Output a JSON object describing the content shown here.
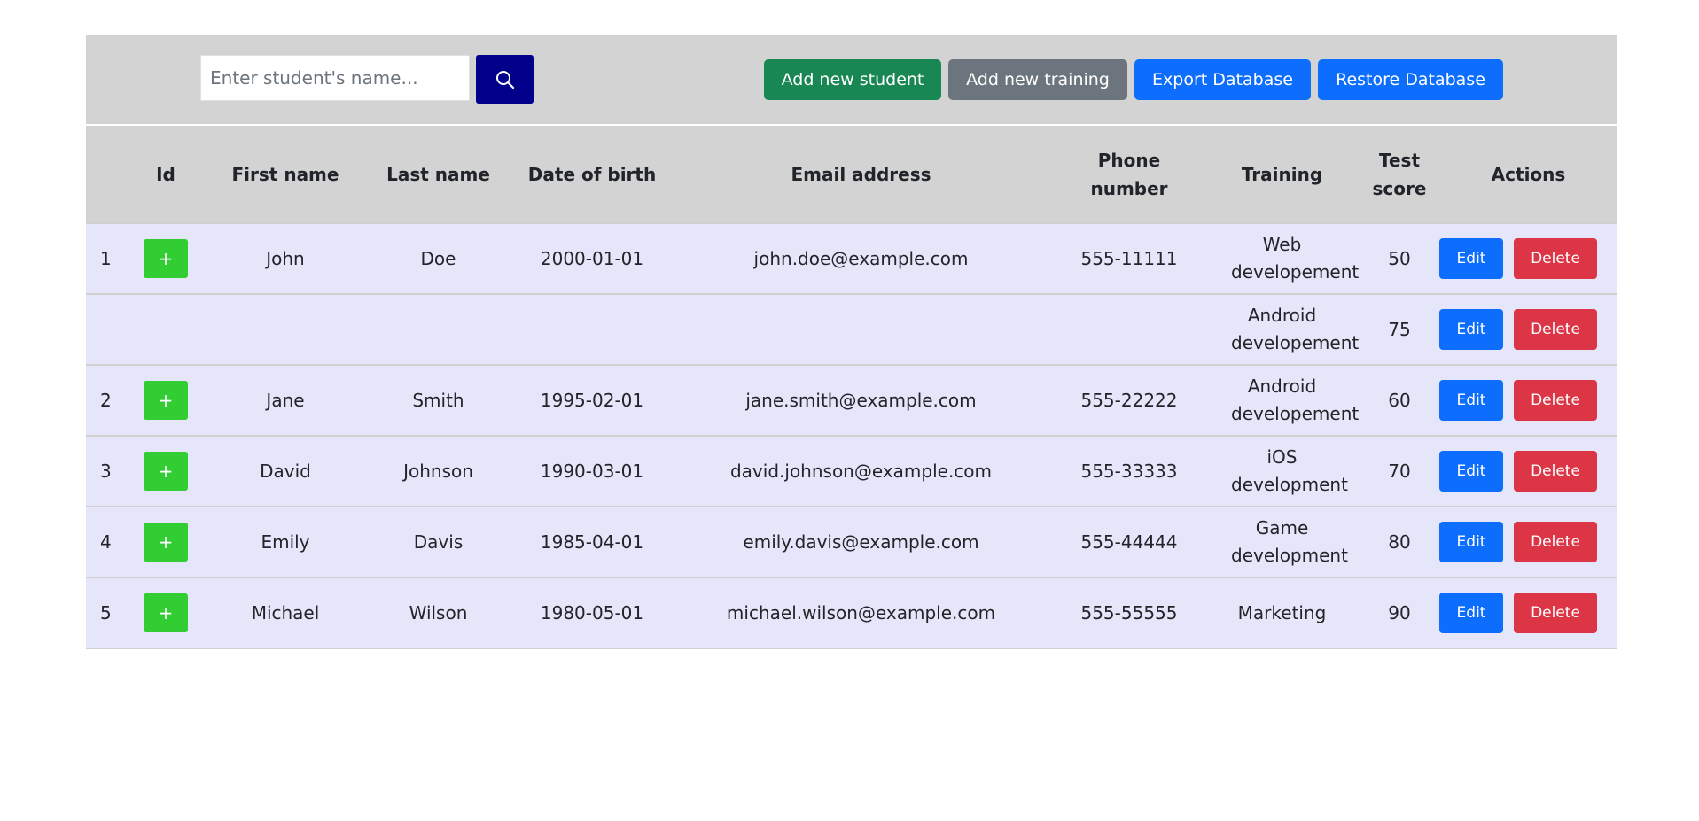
{
  "toolbar": {
    "search_placeholder": "Enter student's name...",
    "search_icon": "search-icon",
    "add_student_label": "Add new student",
    "add_training_label": "Add new training",
    "export_label": "Export Database",
    "restore_label": "Restore Database"
  },
  "table": {
    "headers": [
      "Id",
      "First name",
      "Last name",
      "Date of birth",
      "Email address",
      "Phone number",
      "Training",
      "Test score",
      "Actions"
    ],
    "expand_label": "+",
    "edit_label": "Edit",
    "delete_label": "Delete",
    "rows": [
      {
        "num": "1",
        "first": "John",
        "last": "Doe",
        "dob": "2000-01-01",
        "email": "john.doe@example.com",
        "phone": "555-11111",
        "training": "Web developement",
        "score": "50"
      },
      {
        "num": "",
        "first": "",
        "last": "",
        "dob": "",
        "email": "",
        "phone": "",
        "training": "Android developement",
        "score": "75"
      },
      {
        "num": "2",
        "first": "Jane",
        "last": "Smith",
        "dob": "1995-02-01",
        "email": "jane.smith@example.com",
        "phone": "555-22222",
        "training": "Android developement",
        "score": "60"
      },
      {
        "num": "3",
        "first": "David",
        "last": "Johnson",
        "dob": "1990-03-01",
        "email": "david.johnson@example.com",
        "phone": "555-33333",
        "training": "iOS development",
        "score": "70"
      },
      {
        "num": "4",
        "first": "Emily",
        "last": "Davis",
        "dob": "1985-04-01",
        "email": "emily.davis@example.com",
        "phone": "555-44444",
        "training": "Game development",
        "score": "80"
      },
      {
        "num": "5",
        "first": "Michael",
        "last": "Wilson",
        "dob": "1980-05-01",
        "email": "michael.wilson@example.com",
        "phone": "555-55555",
        "training": "Marketing",
        "score": "90"
      }
    ]
  },
  "colors": {
    "toolbar_bg": "#d3d3d3",
    "row_bg": "#e6e6fa",
    "search_button": "#00008b",
    "add_student": "#198754",
    "add_training": "#6c757d",
    "primary": "#0d6efd",
    "danger": "#dc3545",
    "expand": "#32cd32"
  }
}
